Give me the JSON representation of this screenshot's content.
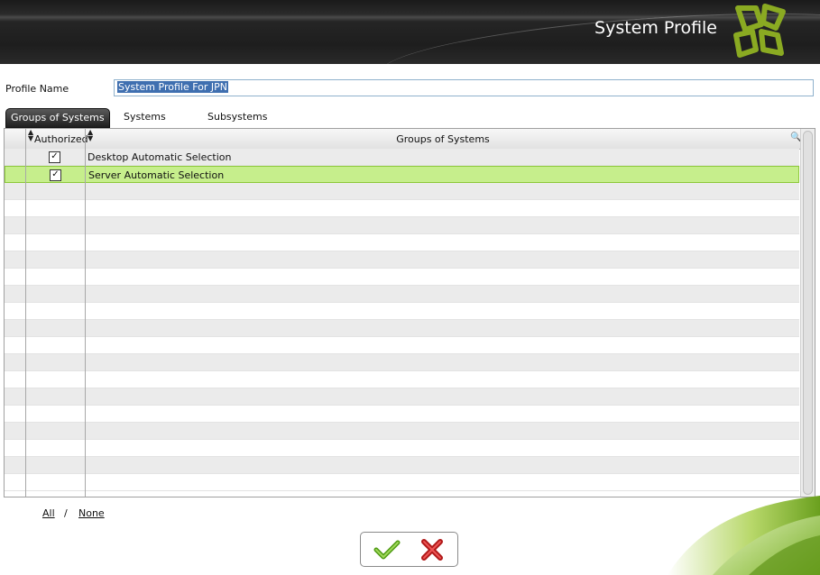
{
  "header": {
    "title": "System Profile"
  },
  "profile": {
    "label": "Profile Name",
    "value": "System Profile For JPN"
  },
  "tabs": [
    {
      "label": "Groups of Systems",
      "active": true
    },
    {
      "label": "Systems",
      "active": false
    },
    {
      "label": "Subsystems",
      "active": false
    }
  ],
  "grid": {
    "columns": {
      "authorized": "Authorized",
      "groups": "Groups of Systems"
    },
    "rows": [
      {
        "authorized": true,
        "name": "Desktop Automatic Selection",
        "selected": false
      },
      {
        "authorized": true,
        "name": "Server Automatic Selection",
        "selected": true
      }
    ],
    "empty_rows": 18
  },
  "selection": {
    "all": "All",
    "separator": "/",
    "none": "None"
  },
  "colors": {
    "accent_green": "#8dc83a",
    "selected_row": "#c6ee8c",
    "header_dark": "#1e1e1e"
  },
  "icons": {
    "ok": "check-icon",
    "cancel": "cross-icon"
  }
}
